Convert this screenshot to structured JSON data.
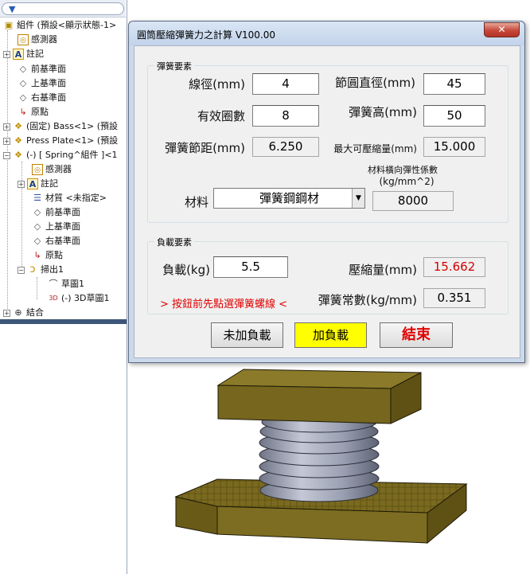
{
  "tree": {
    "filter_icon": "filter-icon",
    "items": [
      {
        "label": "組件 (預設<顯示狀態-1>",
        "icon": "assembly-icon"
      },
      {
        "label": "感測器",
        "icon": "sensor-icon"
      },
      {
        "label": "註記",
        "icon": "annotation-icon"
      },
      {
        "label": "前基準面",
        "icon": "plane-icon"
      },
      {
        "label": "上基準面",
        "icon": "plane-icon"
      },
      {
        "label": "右基準面",
        "icon": "plane-icon"
      },
      {
        "label": "原點",
        "icon": "origin-icon"
      },
      {
        "label": "(固定) Bass<1> (預設",
        "icon": "part-icon"
      },
      {
        "label": "Press Plate<1> (預設",
        "icon": "part-icon"
      },
      {
        "label": "(-) [ Spring^組件 ]<1",
        "icon": "part-icon"
      },
      {
        "label": "感測器",
        "icon": "sensor-icon"
      },
      {
        "label": "註記",
        "icon": "annotation-icon"
      },
      {
        "label": "材質 <未指定>",
        "icon": "material-icon"
      },
      {
        "label": "前基準面",
        "icon": "plane-icon"
      },
      {
        "label": "上基準面",
        "icon": "plane-icon"
      },
      {
        "label": "右基準面",
        "icon": "plane-icon"
      },
      {
        "label": "原點",
        "icon": "origin-icon"
      },
      {
        "label": "掃出1",
        "icon": "sweep-icon"
      },
      {
        "label": "草圖1",
        "icon": "sketch-icon"
      },
      {
        "label": "(-) 3D草圖1",
        "icon": "sketch3d-icon"
      },
      {
        "label": "結合",
        "icon": "mates-icon"
      }
    ]
  },
  "dialog": {
    "title": "圓筒壓縮彈簧力之計算   V100.00",
    "close_label": "✕",
    "spring_group": {
      "title": "彈簧要素",
      "wire_dia_label": "線徑(mm)",
      "wire_dia_value": "4",
      "pitch_dia_label": "節圓直徑(mm)",
      "pitch_dia_value": "45",
      "active_coils_label": "有效圈數",
      "active_coils_value": "8",
      "spring_height_label": "彈簧高(mm)",
      "spring_height_value": "50",
      "pitch_label": "彈簧節距(mm)",
      "pitch_value": "6.250",
      "max_compress_label": "最大可壓縮量(mm)",
      "max_compress_value": "15.000",
      "shear_modulus_label_1": "材料橫向彈性係數",
      "shear_modulus_label_2": "(kg/mm^2)",
      "shear_modulus_value": "8000",
      "material_label": "材料",
      "material_value": "彈簧鋼鋼材"
    },
    "load_group": {
      "title": "負載要素",
      "load_label": "負載(kg)",
      "load_value": "5.5",
      "compression_label": "壓縮量(mm)",
      "compression_value": "15.662",
      "hint": "> 按鈕前先點選彈簧螺線 <",
      "spring_const_label": "彈簧常數(kg/mm)",
      "spring_const_value": "0.351"
    },
    "buttons": {
      "unload": "未加負載",
      "load": "加負載",
      "exit": "結束"
    }
  },
  "colors": {
    "plate": "#7a6a20",
    "spring": "#9aa0b2",
    "warning_red": "#d40000",
    "load_button": "#ffff00"
  }
}
